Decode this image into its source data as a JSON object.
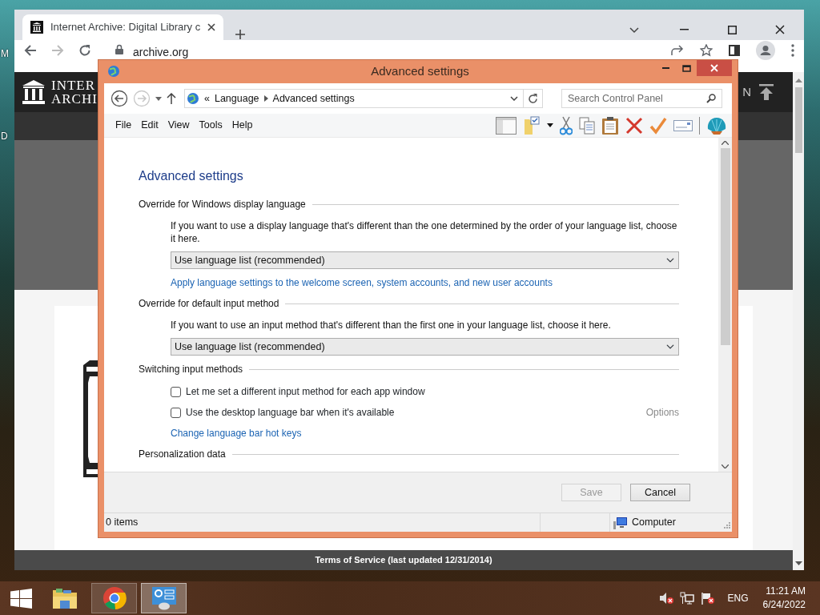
{
  "desktop": {
    "icon_labels": [
      "M",
      "D"
    ]
  },
  "browser": {
    "tab": {
      "title": "Internet Archive: Digital Library c"
    },
    "nav": {
      "back_disabled": false,
      "forward_disabled": true
    },
    "address": "archive.org",
    "logo_lines": [
      "INTER",
      "ARCHI"
    ],
    "header_text": "N",
    "footer": "Terms of Service (last updated 12/31/2014)"
  },
  "dialog": {
    "title": "Advanced settings",
    "nav": {
      "back_disabled": false,
      "forward_disabled": true
    },
    "breadcrumb_prefix": "«",
    "breadcrumb": [
      "Language",
      "Advanced settings"
    ],
    "search": {
      "placeholder": "Search Control Panel"
    },
    "menu": [
      "File",
      "Edit",
      "View",
      "Tools",
      "Help"
    ],
    "heading": "Advanced settings",
    "sections": [
      {
        "title": "Override for Windows display language",
        "items": [
          {
            "kind": "text",
            "text": "If you want to use a display language that's different than the one determined by the order of your language list, choose it here."
          },
          {
            "kind": "select",
            "value": "Use language list (recommended)"
          },
          {
            "kind": "link",
            "text": "Apply language settings to the welcome screen, system accounts, and new user accounts"
          }
        ]
      },
      {
        "title": "Override for default input method",
        "items": [
          {
            "kind": "text",
            "text": "If you want to use an input method that's different than the first one in your language list, choose it here."
          },
          {
            "kind": "select",
            "value": "Use language list (recommended)"
          }
        ]
      },
      {
        "title": "Switching input methods",
        "items": [
          {
            "kind": "checkbox",
            "label": "Let me set a different input method for each app window",
            "checked": false
          },
          {
            "kind": "checkbox",
            "label": "Use the desktop language bar when it's available",
            "checked": false,
            "aside": {
              "text": "Options",
              "disabled": true
            }
          },
          {
            "kind": "link",
            "text": "Change language bar hot keys"
          }
        ]
      },
      {
        "title": "Personalization data"
      }
    ],
    "buttons": [
      {
        "label": "Save",
        "disabled": true
      },
      {
        "label": "Cancel",
        "disabled": false
      }
    ],
    "status_bar": {
      "count": "0 items",
      "zone": "Computer"
    }
  },
  "taskbar": {
    "apps": [
      {
        "kind": "explorer",
        "running": false,
        "selected": false
      },
      {
        "kind": "browser",
        "running": true,
        "selected": false
      },
      {
        "kind": "control-panel",
        "running": true,
        "selected": true
      }
    ],
    "language": "ENG",
    "time": "11:21 AM",
    "date": "6/24/2022"
  }
}
